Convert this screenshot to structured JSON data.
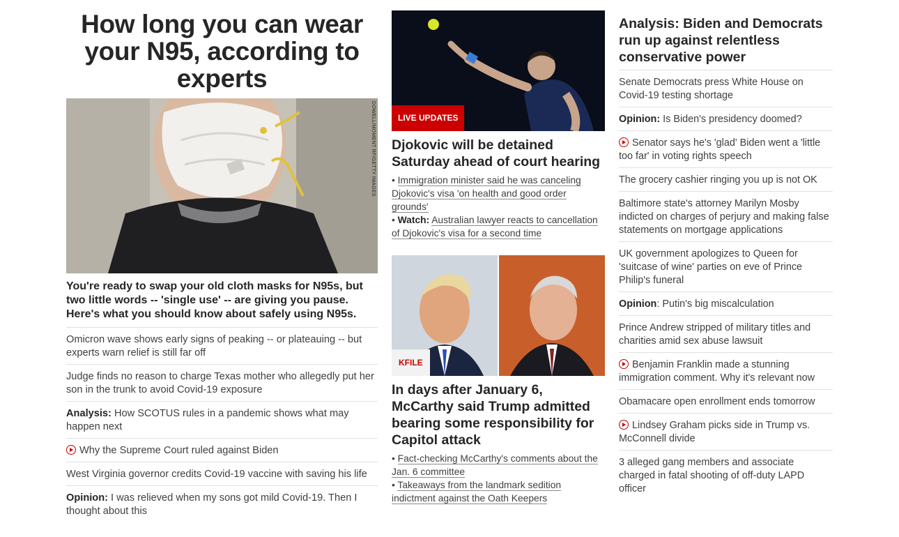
{
  "column1": {
    "headline": "How long you can wear your N95, according to experts",
    "hero_image_credit": "DOWELL/MOMENT RF/GETTY IMAGES",
    "hero_summary": "You're ready to swap your old cloth masks for N95s, but two little words -- 'single use' -- are giving you pause. Here's what you should know about safely using N95s.",
    "stories": [
      {
        "prefix": "",
        "text": "Omicron wave shows early signs of peaking -- or plateauing -- but experts warn relief is still far off",
        "video": false
      },
      {
        "prefix": "",
        "text": "Judge finds no reason to charge Texas mother who allegedly put her son in the trunk to avoid Covid-19 exposure",
        "video": false
      },
      {
        "prefix": "Analysis:",
        "text": " How SCOTUS rules in a pandemic shows what may happen next",
        "video": false
      },
      {
        "prefix": "",
        "text": "Why the Supreme Court ruled against Biden",
        "video": true
      },
      {
        "prefix": "",
        "text": "West Virginia governor credits Covid-19 vaccine with saving his life",
        "video": false
      },
      {
        "prefix": "Opinion:",
        "text": " I was relieved when my sons got mild Covid-19. Then I thought about this",
        "video": false
      }
    ]
  },
  "column2": {
    "card1": {
      "badge": "LIVE UPDATES",
      "title": "Djokovic will be detained Saturday ahead of court hearing",
      "bullets": [
        {
          "prefix": "",
          "text": "Immigration minister said he was canceling Djokovic's visa 'on health and good order grounds'"
        },
        {
          "prefix": "Watch:",
          "text": "Australian lawyer reacts to cancellation of Djokovic's visa for a second time"
        }
      ]
    },
    "card2": {
      "badge": "KFILE",
      "title": "In days after January 6, McCarthy said Trump admitted bearing some responsibility for Capitol attack",
      "bullets": [
        {
          "prefix": "",
          "text": "Fact-checking McCarthy's comments about the Jan. 6 committee"
        },
        {
          "prefix": "",
          "text": "Takeaways from the landmark sedition indictment against the Oath Keepers"
        }
      ]
    }
  },
  "column3": {
    "headline": "Analysis: Biden and Democrats run up against relentless conservative power",
    "stories": [
      {
        "prefix": "",
        "text": "Senate Democrats press White House on Covid-19 testing shortage",
        "video": false
      },
      {
        "prefix": "Opinion:",
        "text": " Is Biden's presidency doomed?",
        "video": false
      },
      {
        "prefix": "",
        "text": "Senator says he's 'glad' Biden went a 'little too far' in voting rights speech",
        "video": true
      },
      {
        "prefix": "",
        "text": "The grocery cashier ringing you up is not OK",
        "video": false
      },
      {
        "prefix": "",
        "text": "Baltimore state's attorney Marilyn Mosby indicted on charges of perjury and making false statements on mortgage applications",
        "video": false
      },
      {
        "prefix": "",
        "text": "UK government apologizes to Queen for 'suitcase of wine' parties on eve of Prince Philip's funeral",
        "video": false
      },
      {
        "prefix": "Opinion",
        "text": ": Putin's big miscalculation",
        "video": false
      },
      {
        "prefix": "",
        "text": "Prince Andrew stripped of military titles and charities amid sex abuse lawsuit",
        "video": false
      },
      {
        "prefix": "",
        "text": "Benjamin Franklin made a stunning immigration comment. Why it's relevant now",
        "video": true
      },
      {
        "prefix": "",
        "text": "Obamacare open enrollment ends tomorrow",
        "video": false
      },
      {
        "prefix": "",
        "text": "Lindsey Graham picks side in Trump vs. McConnell divide",
        "video": true
      },
      {
        "prefix": "",
        "text": "3 alleged gang members and associate charged in fatal shooting of off-duty LAPD officer",
        "video": false
      }
    ]
  },
  "colors": {
    "accent_red": "#cc0000",
    "text_dark": "#262626",
    "text_body": "#404040",
    "divider": "#e1e1e1"
  }
}
